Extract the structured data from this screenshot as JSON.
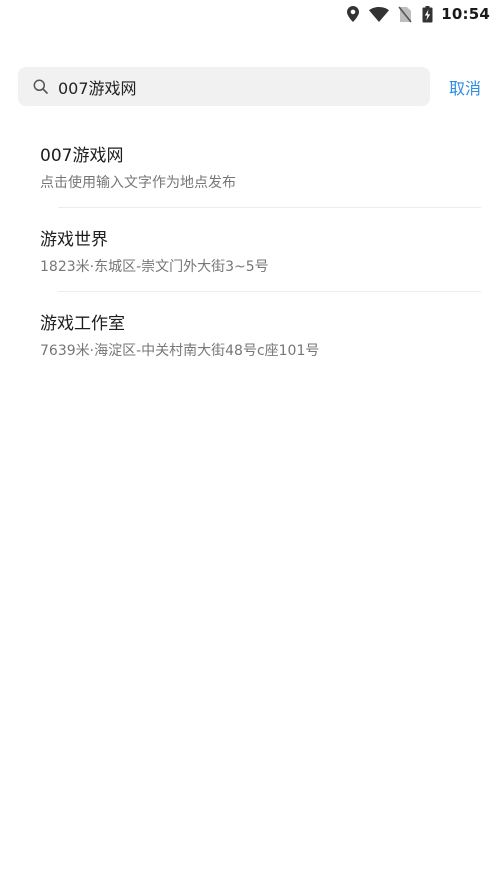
{
  "status_bar": {
    "time": "10:54",
    "icons": [
      "location-icon",
      "wifi-icon",
      "no-sim-icon",
      "battery-charging-icon"
    ]
  },
  "search": {
    "query": "007游戏网",
    "cancel_label": "取消"
  },
  "results": [
    {
      "title": "007游戏网",
      "subtitle": "点击使用输入文字作为地点发布"
    },
    {
      "title": "游戏世界",
      "subtitle": "1823米·东城区-崇文门外大街3~5号"
    },
    {
      "title": "游戏工作室",
      "subtitle": "7639米·海淀区-中关村南大街48号c座101号"
    }
  ],
  "colors": {
    "accent": "#2d8ce6",
    "search_bg": "#f1f1f1",
    "subtitle": "#777777"
  }
}
